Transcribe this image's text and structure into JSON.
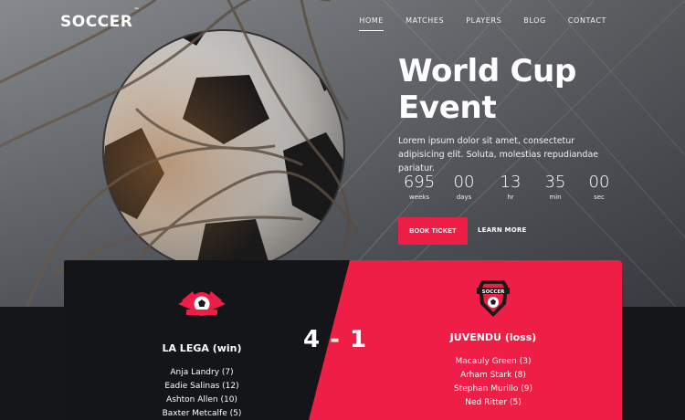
{
  "brand": {
    "logo": "SOCCER",
    "tm": "™"
  },
  "nav": {
    "items": [
      "HOME",
      "MATCHES",
      "PLAYERS",
      "BLOG",
      "CONTACT"
    ]
  },
  "hero": {
    "title_line1": "World Cup",
    "title_line2": "Event",
    "text": "Lorem ipsum dolor sit amet, consectetur adipisicing elit. Soluta, molestias repudiandae pariatur.",
    "countdown": [
      {
        "value": "695",
        "label": "weeks"
      },
      {
        "value": "00",
        "label": "days"
      },
      {
        "value": "13",
        "label": "hr"
      },
      {
        "value": "35",
        "label": "min"
      },
      {
        "value": "00",
        "label": "sec"
      }
    ],
    "book_label": "BOOK TICKET",
    "learn_label": "LEARN MORE"
  },
  "match": {
    "home": {
      "name": "LA LEGA (win)",
      "players": [
        "Anja Landry (7)",
        "Eadie Salinas (12)",
        "Ashton Allen (10)",
        "Baxter Metcalfe (5)"
      ]
    },
    "away": {
      "name": "JUVENDU (loss)",
      "players": [
        "Macauly Green (3)",
        "Arham Stark (8)",
        "Stephan Murillo (9)",
        "Ned Ritter (5)"
      ]
    },
    "score": "4 - 1",
    "badge_text": "SOCCER"
  },
  "colors": {
    "accent": "#ee1e46",
    "dark": "#131519"
  }
}
